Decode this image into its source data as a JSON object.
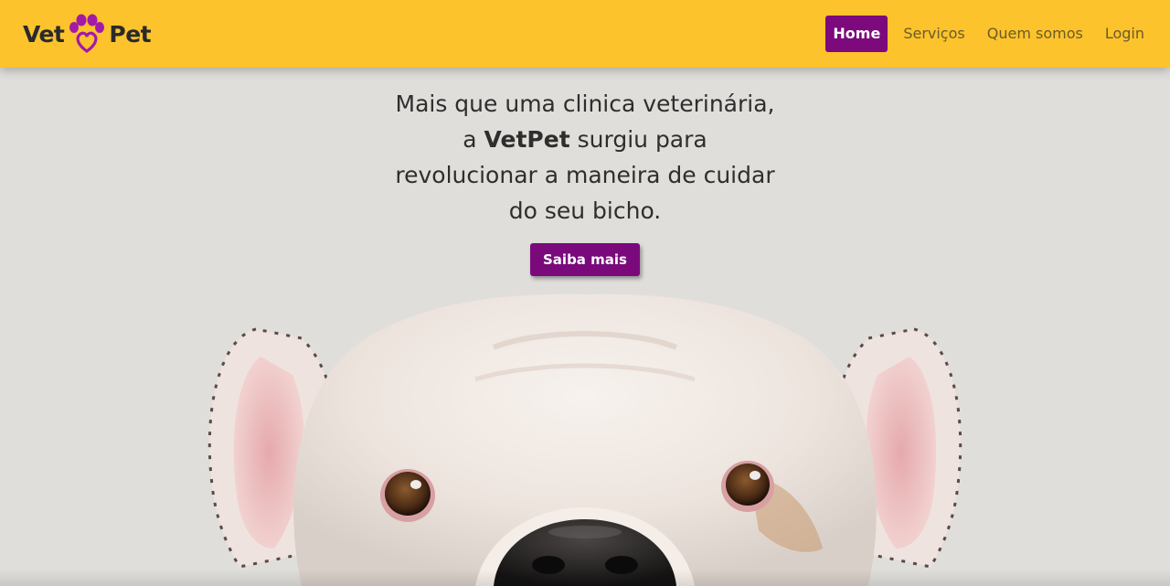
{
  "brand": {
    "word_left": "Vet",
    "word_right": "Pet",
    "icon": "paw-heart-icon",
    "primary_color": "#7c0a7c",
    "navbar_color": "#fcc32c"
  },
  "nav": {
    "items": [
      {
        "label": "Home",
        "active": true
      },
      {
        "label": "Serviços",
        "active": false
      },
      {
        "label": "Quem somos",
        "active": false
      },
      {
        "label": "Login",
        "active": false
      }
    ]
  },
  "hero": {
    "line1": "Mais que uma clinica veterinária,",
    "line2_pre": "a",
    "line2_bold": "VetPet",
    "line2_post": "surgiu para",
    "line3": "revolucionar a maneira de cuidar",
    "line4": "do seu bicho.",
    "cta_label": "Saiba mais"
  }
}
